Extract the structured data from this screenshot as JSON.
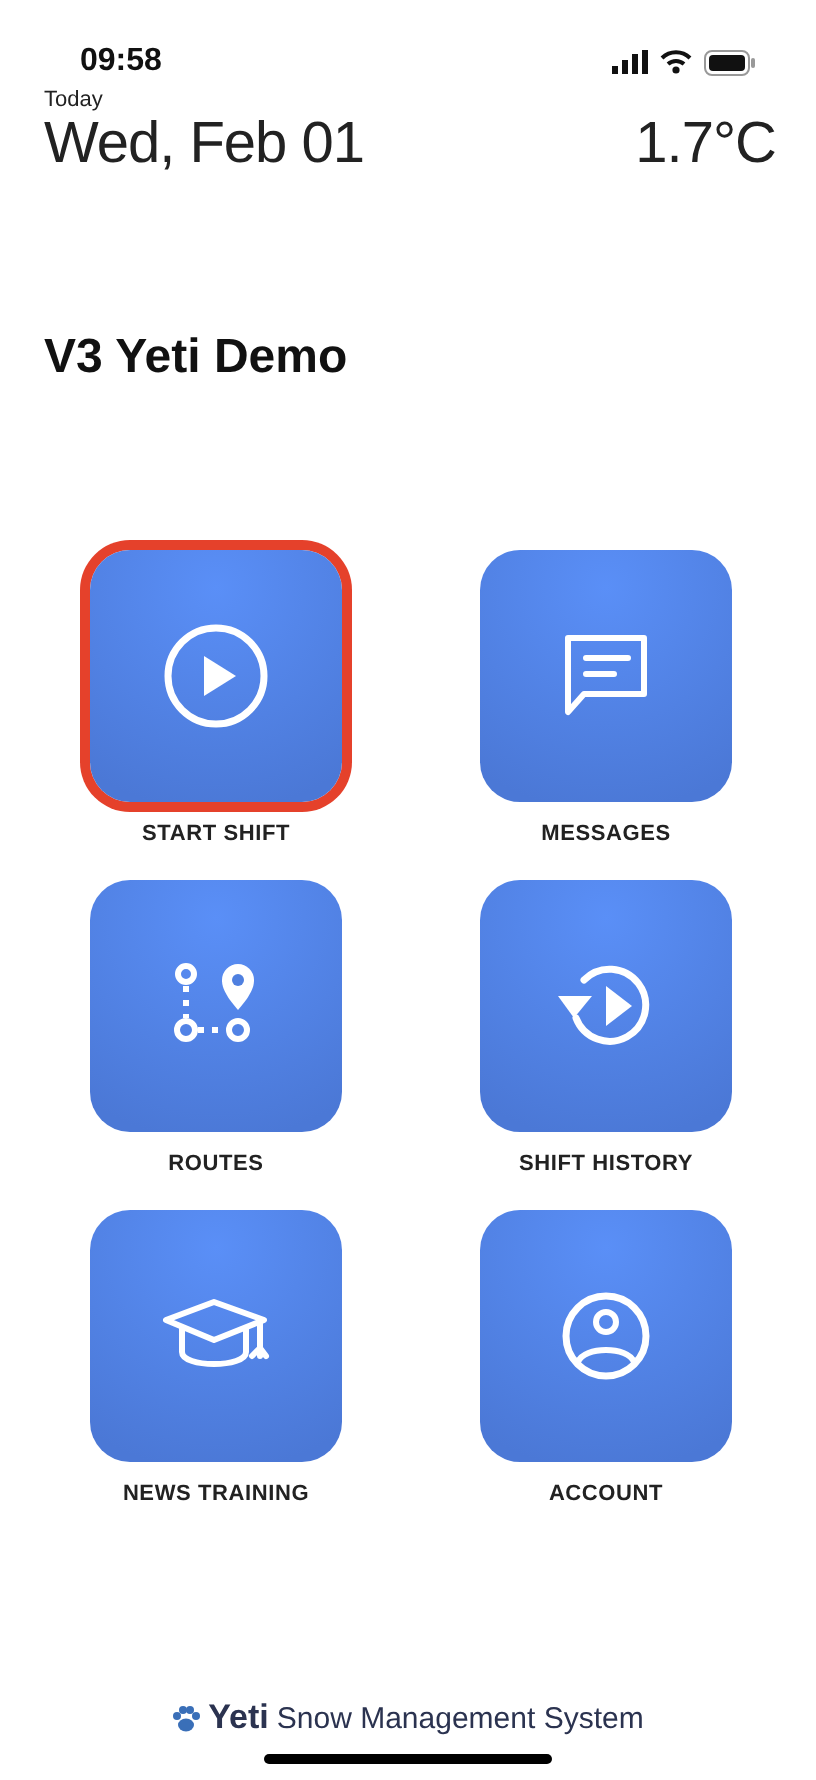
{
  "status_bar": {
    "time": "09:58"
  },
  "header": {
    "day_label": "Today",
    "date": "Wed, Feb 01",
    "temperature": "1.7°C"
  },
  "title": "V3 Yeti Demo",
  "tiles": [
    {
      "label": "START SHIFT",
      "selected": true
    },
    {
      "label": "MESSAGES",
      "selected": false
    },
    {
      "label": "ROUTES",
      "selected": false
    },
    {
      "label": "SHIFT HISTORY",
      "selected": false
    },
    {
      "label": "NEWS TRAINING",
      "selected": false
    },
    {
      "label": "ACCOUNT",
      "selected": false
    }
  ],
  "footer": {
    "brand": "Yeti",
    "tagline": "Snow Management System"
  }
}
